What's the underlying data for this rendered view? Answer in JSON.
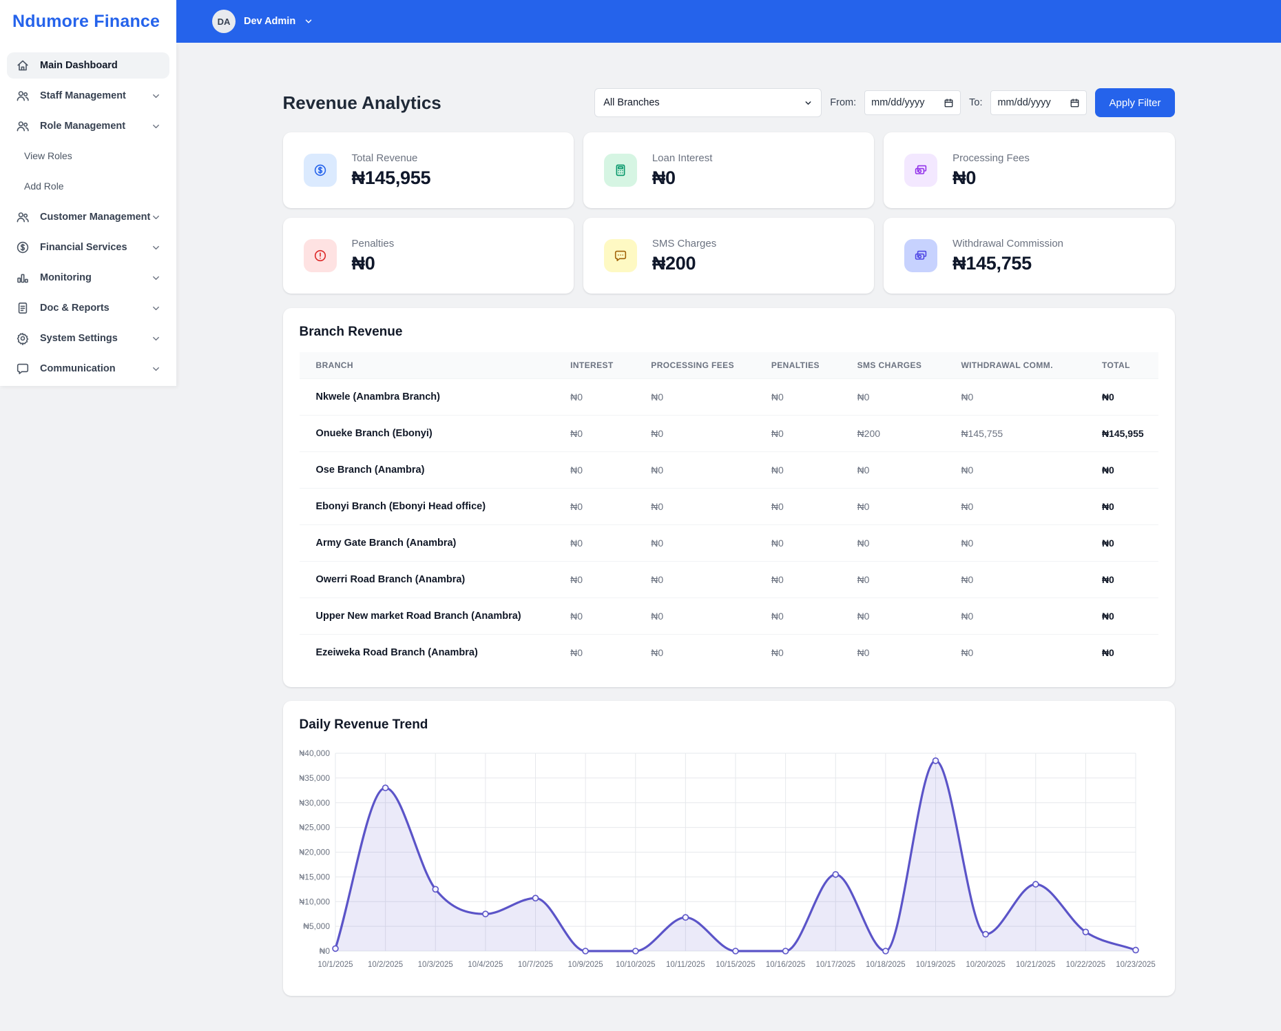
{
  "brand": {
    "name": "Ndumore Finance"
  },
  "topbar": {
    "avatar_initials": "DA",
    "user_name": "Dev Admin"
  },
  "colors": {
    "accent": "#2563eb",
    "chart_line": "#5b54c8",
    "chart_fill": "rgba(99,91,205,0.13)"
  },
  "sidebar": {
    "items": [
      {
        "label": "Main Dashboard",
        "icon": "home",
        "active": true
      },
      {
        "label": "Staff Management",
        "icon": "users",
        "chevron": true
      },
      {
        "label": "Role Management",
        "icon": "users",
        "chevron": true
      },
      {
        "label": "View Roles",
        "sub": true
      },
      {
        "label": "Add Role",
        "sub": true
      },
      {
        "label": "Customer Management",
        "icon": "users",
        "chevron": true
      },
      {
        "label": "Financial Services",
        "icon": "dollar-circle",
        "chevron": true
      },
      {
        "label": "Monitoring",
        "icon": "bar-chart",
        "chevron": true
      },
      {
        "label": "Doc & Reports",
        "icon": "document",
        "chevron": true
      },
      {
        "label": "System Settings",
        "icon": "gear",
        "chevron": true
      },
      {
        "label": "Communication",
        "icon": "chat",
        "chevron": true
      }
    ]
  },
  "page": {
    "title": "Revenue Analytics"
  },
  "filters": {
    "branch_select_value": "All Branches",
    "from_label": "From:",
    "to_label": "To:",
    "date_placeholder": "mm/dd/yyyy",
    "apply_label": "Apply Filter"
  },
  "stats": [
    {
      "label": "Total Revenue",
      "value": "₦145,955",
      "icon": "dollar-circle",
      "icon_bg": "#dbeafe",
      "icon_color": "#2563eb"
    },
    {
      "label": "Loan Interest",
      "value": "₦0",
      "icon": "calculator",
      "icon_bg": "#d6f5e3",
      "icon_color": "#059669"
    },
    {
      "label": "Processing Fees",
      "value": "₦0",
      "icon": "banknotes",
      "icon_bg": "#f3e8ff",
      "icon_color": "#9333ea"
    },
    {
      "label": "Penalties",
      "value": "₦0",
      "icon": "alert-circle",
      "icon_bg": "#fee2e2",
      "icon_color": "#dc2626"
    },
    {
      "label": "SMS Charges",
      "value": "₦200",
      "icon": "chat-dots",
      "icon_bg": "#fef9c3",
      "icon_color": "#a16207"
    },
    {
      "label": "Withdrawal Commission",
      "value": "₦145,755",
      "icon": "banknotes",
      "icon_bg": "#c7d2fe",
      "icon_color": "#4f46e5"
    }
  ],
  "table": {
    "title": "Branch Revenue",
    "columns": [
      "BRANCH",
      "INTEREST",
      "PROCESSING FEES",
      "PENALTIES",
      "SMS CHARGES",
      "WITHDRAWAL COMM.",
      "TOTAL"
    ],
    "rows": [
      [
        "Nkwele (Anambra Branch)",
        "₦0",
        "₦0",
        "₦0",
        "₦0",
        "₦0",
        "₦0"
      ],
      [
        "Onueke Branch (Ebonyi)",
        "₦0",
        "₦0",
        "₦0",
        "₦200",
        "₦145,755",
        "₦145,955"
      ],
      [
        "Ose Branch (Anambra)",
        "₦0",
        "₦0",
        "₦0",
        "₦0",
        "₦0",
        "₦0"
      ],
      [
        "Ebonyi Branch (Ebonyi Head office)",
        "₦0",
        "₦0",
        "₦0",
        "₦0",
        "₦0",
        "₦0"
      ],
      [
        "Army Gate Branch (Anambra)",
        "₦0",
        "₦0",
        "₦0",
        "₦0",
        "₦0",
        "₦0"
      ],
      [
        "Owerri Road Branch (Anambra)",
        "₦0",
        "₦0",
        "₦0",
        "₦0",
        "₦0",
        "₦0"
      ],
      [
        "Upper New market Road Branch (Anambra)",
        "₦0",
        "₦0",
        "₦0",
        "₦0",
        "₦0",
        "₦0"
      ],
      [
        "Ezeiweka Road Branch (Anambra)",
        "₦0",
        "₦0",
        "₦0",
        "₦0",
        "₦0",
        "₦0"
      ]
    ]
  },
  "chart_data": {
    "type": "area",
    "title": "Daily Revenue Trend",
    "x": [
      "10/1/2025",
      "10/2/2025",
      "10/3/2025",
      "10/4/2025",
      "10/7/2025",
      "10/9/2025",
      "10/10/2025",
      "10/11/2025",
      "10/15/2025",
      "10/16/2025",
      "10/17/2025",
      "10/18/2025",
      "10/19/2025",
      "10/20/2025",
      "10/21/2025",
      "10/22/2025",
      "10/23/2025"
    ],
    "values": [
      500,
      33000,
      12500,
      7500,
      10700,
      0,
      0,
      6800,
      0,
      0,
      15500,
      0,
      38500,
      3400,
      13500,
      3855,
      200
    ],
    "ylim": [
      0,
      40000
    ],
    "ytick_step": 5000,
    "ytick_labels": [
      "₦0",
      "₦5,000",
      "₦10,000",
      "₦15,000",
      "₦20,000",
      "₦25,000",
      "₦30,000",
      "₦35,000",
      "₦40,000"
    ],
    "xlabel": "",
    "ylabel": "",
    "grid": true,
    "legend": false
  }
}
